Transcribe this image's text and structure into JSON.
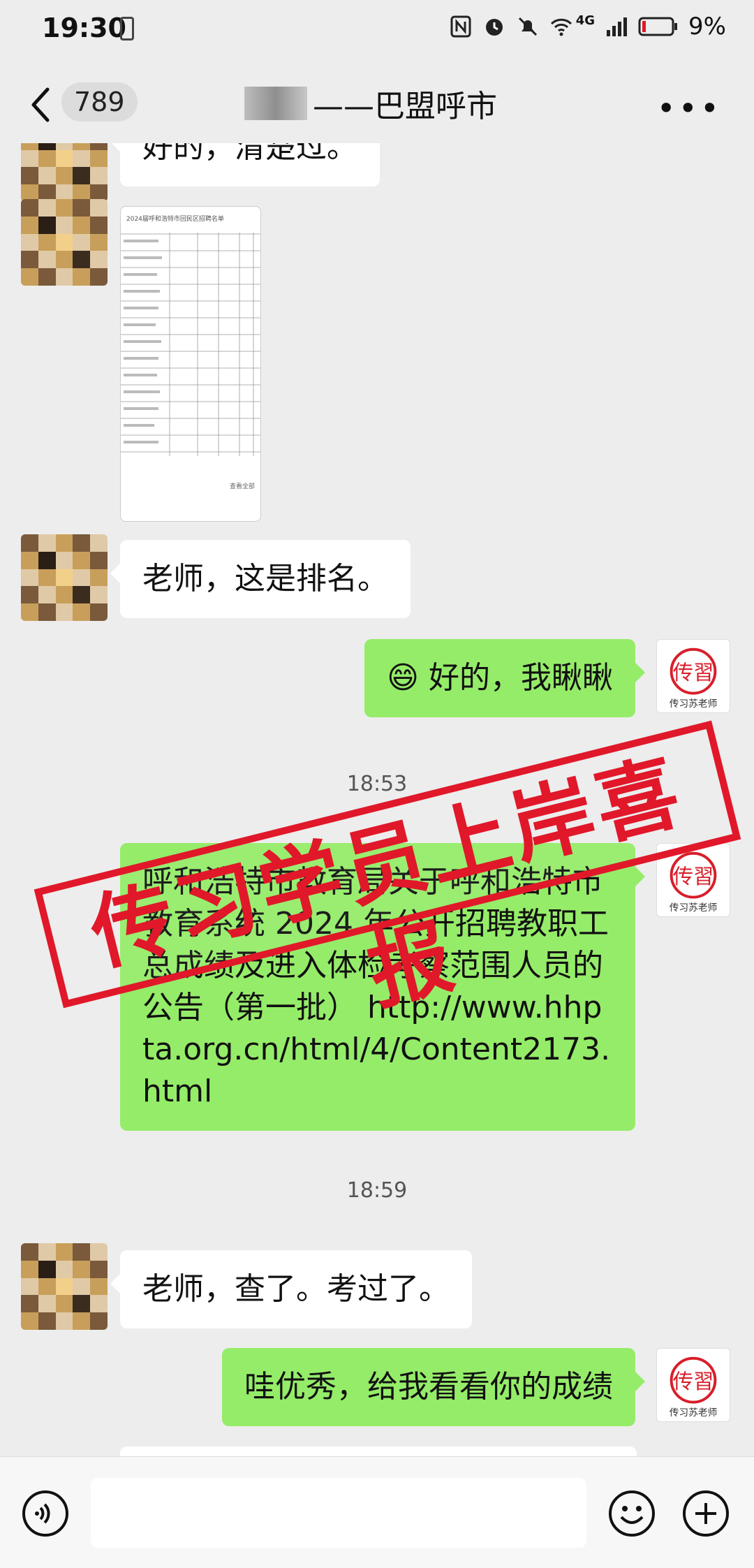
{
  "status_bar": {
    "time": "19:30",
    "network_label": "4G",
    "battery_percent": "9%",
    "icons": [
      "sim-icon",
      "nfc-icon",
      "alarm-icon",
      "mute-icon",
      "wifi-icon",
      "signal-icon",
      "battery-icon"
    ]
  },
  "header": {
    "unread_count": "789",
    "title": "——巴盟呼市",
    "icons": [
      "back-icon",
      "more-icon"
    ]
  },
  "messages": [
    {
      "side": "left",
      "text": "好的，清楚过。"
    },
    {
      "side": "left",
      "type": "image",
      "image_title": "2024届呼和浩特市回民区招聘名单",
      "image_footer": "查看全部"
    },
    {
      "side": "left",
      "text": "老师，这是排名。"
    },
    {
      "side": "right",
      "text": "😄 好的，我瞅瞅",
      "sender_label": "传习苏老师"
    },
    {
      "type": "time",
      "text": "18:53"
    },
    {
      "side": "right",
      "text": "呼和浩特市教育局关于呼和浩特市教育系统 2024 年公开招聘教职工总成绩及进入体检考察范围人员的公告（第一批） http://www.hhpta.org.cn/html/4/Content2173.html",
      "sender_label": "传习苏老师"
    },
    {
      "type": "time",
      "text": "18:59"
    },
    {
      "side": "left",
      "text": "老师，查了。考过了。"
    },
    {
      "side": "right",
      "text": "哇优秀，给我看看你的成绩",
      "sender_label": "传习苏老师"
    }
  ],
  "stamp": {
    "text": "传习学员上岸喜报"
  },
  "bottom_bar": {
    "icons": [
      "voice-icon",
      "emoji-icon",
      "plus-icon"
    ]
  },
  "colors": {
    "accent_green": "#95ec69",
    "stamp_red": "#e0182a",
    "background": "#ededed"
  }
}
